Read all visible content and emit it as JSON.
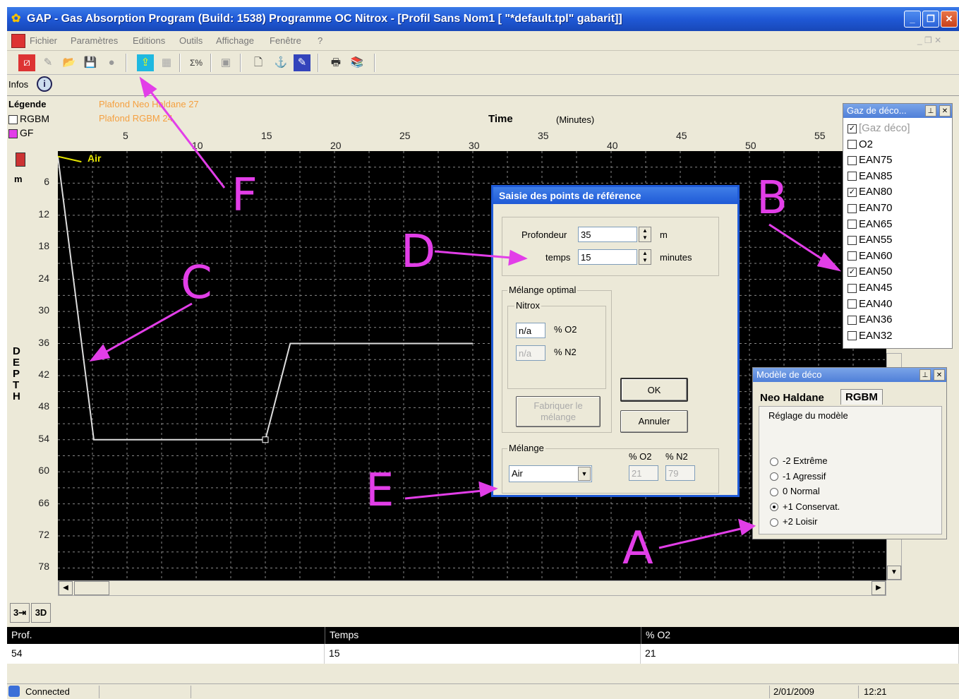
{
  "window": {
    "title": "GAP - Gas Absorption Program (Build: 1538)  Programme OC Nitrox - [Profil Sans Nom1 [ \"*default.tpl\" gabarit]]",
    "minimize_label": "_",
    "restore_label": "❐",
    "close_label": "✕"
  },
  "menu": {
    "items": [
      "Fichier",
      "Paramètres",
      "Editions",
      "Outils",
      "Affichage",
      "Fenêtre",
      "?"
    ]
  },
  "infobar": {
    "label": "Infos"
  },
  "legend": {
    "title": "Légende",
    "items": [
      {
        "label": "RGBM",
        "color": "#ffffff"
      },
      {
        "label": "GF",
        "color": "#e23ee8"
      }
    ],
    "plafonds": [
      "Plafond Neo Haldane 27",
      "Plafond RGBM 24"
    ]
  },
  "chart": {
    "xlabel": "Time",
    "xunit": "(Minutes)",
    "x_ticks": [
      "5",
      "10",
      "15",
      "20",
      "25",
      "30",
      "35",
      "40",
      "45",
      "50",
      "55"
    ],
    "ylabel": "DEPTH",
    "yunit": "m",
    "y_ticks": [
      "6",
      "12",
      "18",
      "24",
      "30",
      "36",
      "42",
      "48",
      "54",
      "60",
      "66",
      "72",
      "78"
    ],
    "gas_label": "Air"
  },
  "chart_data": {
    "type": "line",
    "xlabel": "Time",
    "ylabel": "DEPTH",
    "xlim": [
      0,
      60
    ],
    "ylim": [
      0,
      80
    ],
    "grid": true,
    "series": [
      {
        "color": "#dddddd",
        "x": [
          0,
          2.6,
          15,
          16.8,
          30
        ],
        "y": [
          1,
          54,
          54,
          36,
          36
        ]
      },
      {
        "color": "#e6e600",
        "x": [
          0,
          1.7
        ],
        "y": [
          1,
          2
        ]
      }
    ]
  },
  "dialog": {
    "title": "Saisie des points de référence",
    "profondeur_label": "Profondeur",
    "profondeur_value": "35",
    "profondeur_unit": "m",
    "temps_label": "temps",
    "temps_value": "15",
    "temps_unit": "minutes",
    "melange_optimal_label": "Mélange optimal",
    "nitrox_label": "Nitrox",
    "o2_opt_value": "n/a",
    "o2_opt_label": "% O2",
    "n2_opt_value": "n/a",
    "n2_opt_label": "% N2",
    "fabriquer_label_1": "Fabriquer le",
    "fabriquer_label_2": "mélange",
    "ok_label": "OK",
    "annuler_label": "Annuler",
    "melange_label": "Mélange",
    "melange_value": "Air",
    "o2_col": "% O2",
    "n2_col": "% N2",
    "o2_value": "21",
    "n2_value": "79"
  },
  "gas_panel": {
    "title": "Gaz de déco...",
    "items": [
      {
        "label": "[Gaz déco]",
        "checked": true,
        "disabled": true
      },
      {
        "label": "O2",
        "checked": false
      },
      {
        "label": "EAN75",
        "checked": false
      },
      {
        "label": "EAN85",
        "checked": false
      },
      {
        "label": "EAN80",
        "checked": true
      },
      {
        "label": "EAN70",
        "checked": false
      },
      {
        "label": "EAN65",
        "checked": false
      },
      {
        "label": "EAN55",
        "checked": false
      },
      {
        "label": "EAN60",
        "checked": false
      },
      {
        "label": "EAN50",
        "checked": true
      },
      {
        "label": "EAN45",
        "checked": false
      },
      {
        "label": "EAN40",
        "checked": false
      },
      {
        "label": "EAN36",
        "checked": false
      },
      {
        "label": "EAN32",
        "checked": false
      }
    ]
  },
  "model_panel": {
    "title": "Modèle de déco",
    "tabs": [
      "Neo Haldane",
      "RGBM"
    ],
    "subtitle": "Réglage du modèle",
    "options": [
      {
        "label": "-2 Extrême",
        "selected": false
      },
      {
        "label": "-1 Agressif",
        "selected": false
      },
      {
        "label": "0 Normal",
        "selected": false
      },
      {
        "label": "+1 Conservat.",
        "selected": true
      },
      {
        "label": "+2 Loisir",
        "selected": false
      }
    ]
  },
  "table": {
    "headers": [
      "Prof.",
      "Temps",
      "% O2"
    ],
    "row": [
      "54",
      "15",
      "21"
    ]
  },
  "statusbar": {
    "status": "Connected",
    "date": "2/01/2009",
    "time": "12:21"
  },
  "annotations": {
    "letters": [
      "A",
      "B",
      "C",
      "D",
      "E",
      "F"
    ],
    "color": "#e23ee8"
  }
}
